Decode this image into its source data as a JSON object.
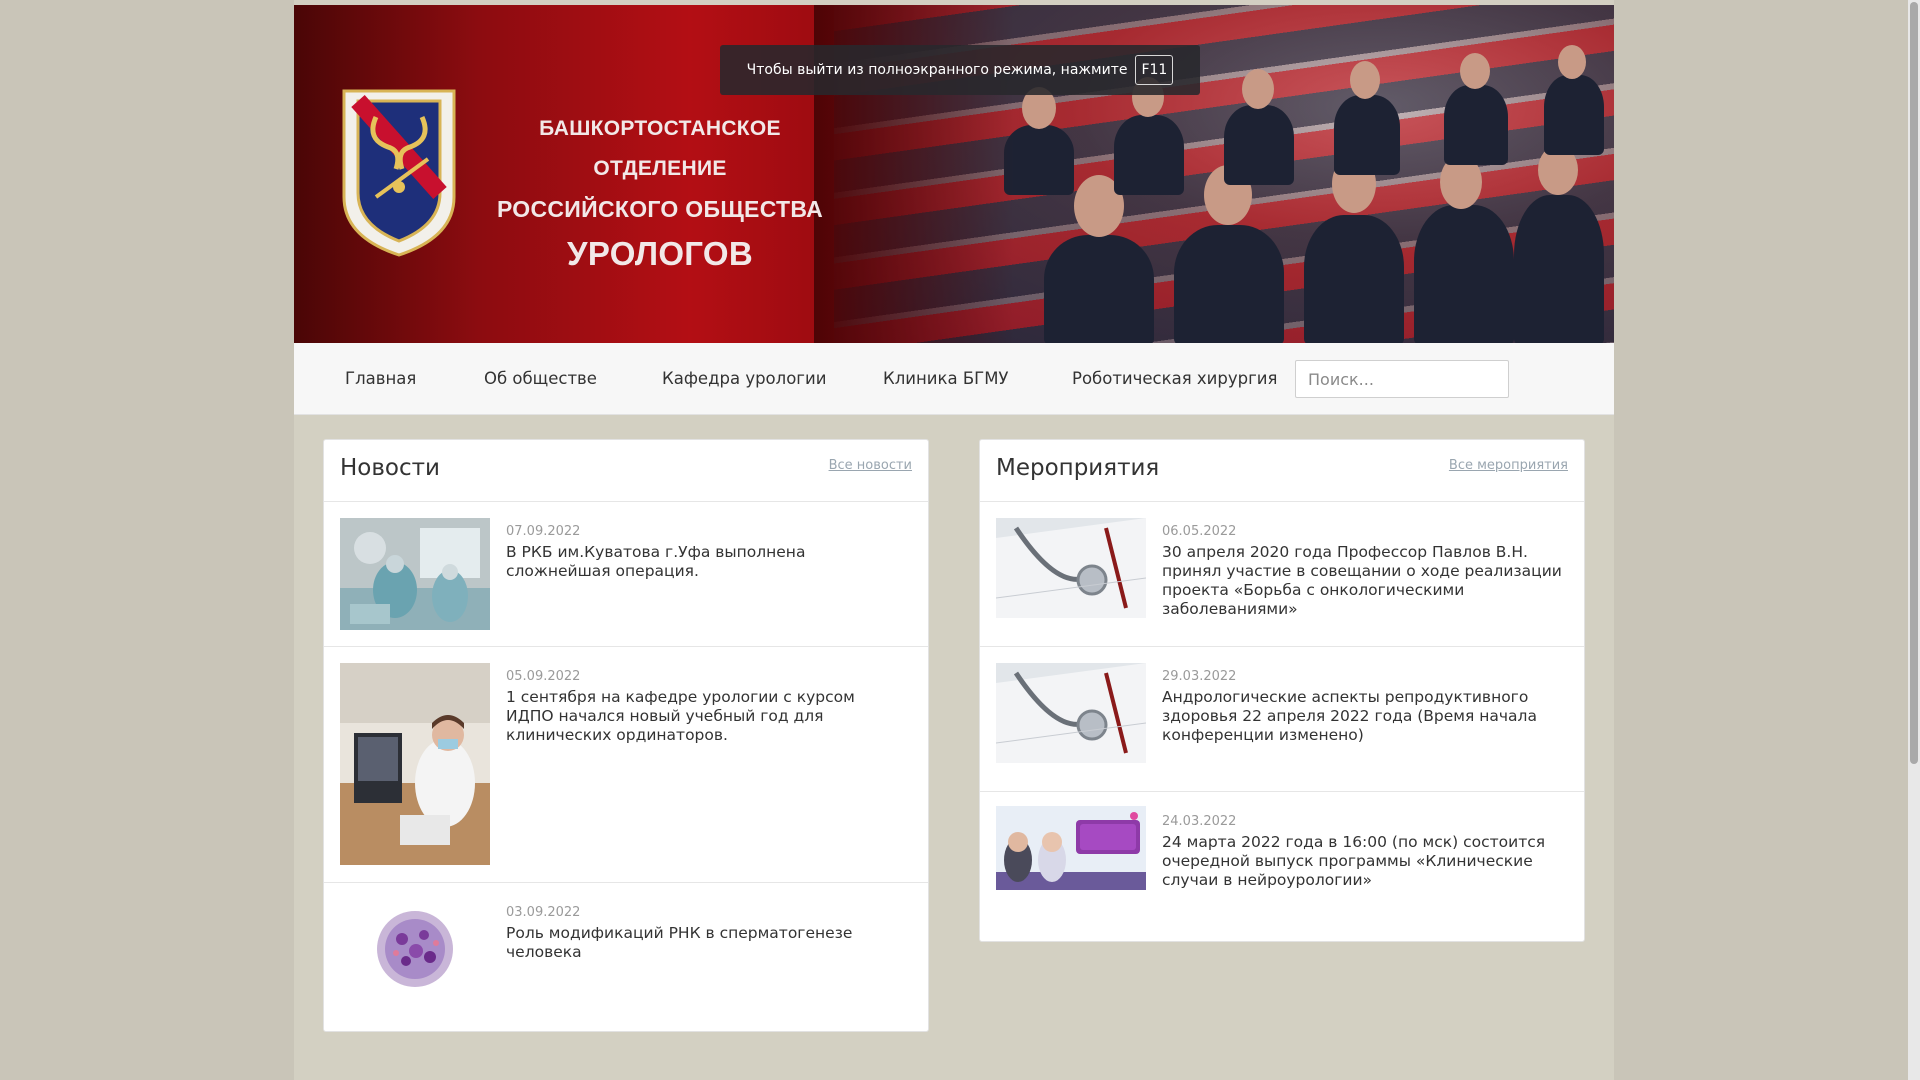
{
  "banner": {
    "title_line1": "БАШКОРТОСТАНСКОЕ ОТДЕЛЕНИЕ",
    "title_line2": "РОССИЙСКОГО ОБЩЕСТВА",
    "title_line3": "УРОЛОГОВ",
    "fullscreen_tip": "Чтобы выйти из полноэкранного режима, нажмите",
    "fullscreen_key": "F11"
  },
  "nav": {
    "items": [
      {
        "label": "Главная"
      },
      {
        "label": "Об обществе"
      },
      {
        "label": "Кафедра урологии"
      },
      {
        "label": "Клиника БГМУ"
      },
      {
        "label": "Роботическая хирургия"
      }
    ],
    "search_placeholder": "Поиск..."
  },
  "news": {
    "title": "Новости",
    "all_link": "Все новости",
    "items": [
      {
        "date": "07.09.2022",
        "text": "В РКБ им.Куватова г.Уфа выполнена сложнейшая операция."
      },
      {
        "date": "05.09.2022",
        "text": "1 сентября на кафедре урологии с курсом ИДПО начался новый учебный год для клинических ординаторов."
      },
      {
        "date": "03.09.2022",
        "text": "Роль модификаций РНК в сперматогенезе человека"
      }
    ]
  },
  "events": {
    "title": "Мероприятия",
    "all_link": "Все мероприятия",
    "items": [
      {
        "date": "06.05.2022",
        "text": "30 апреля 2020 года Профессор Павлов В.Н. принял участие в совещании о ходе реализации проекта «Борьба с онкологическими заболеваниями»"
      },
      {
        "date": "29.03.2022",
        "text": "Андрологические аспекты репродуктивного здоровья 22 апреля 2022 года (Время начала конференции изменено)"
      },
      {
        "date": "24.03.2022",
        "text": "24 марта 2022 года в 16:00 (по мск) состоится очередной выпуск программы «Клинические случаи в нейроурологии»"
      }
    ]
  },
  "colors": {
    "banner_red": "#b30e14",
    "page_bg": "#d3cfc2",
    "link_muted": "#9aa6b0"
  }
}
